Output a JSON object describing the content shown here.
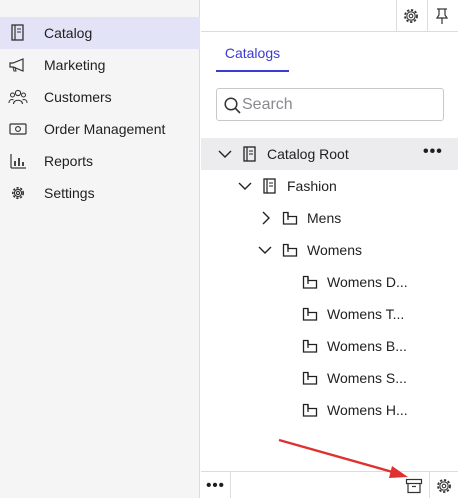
{
  "nav": {
    "items": [
      {
        "label": "Catalog",
        "icon": "catalog-book-icon",
        "active": true
      },
      {
        "label": "Marketing",
        "icon": "megaphone-icon",
        "active": false
      },
      {
        "label": "Customers",
        "icon": "people-icon",
        "active": false
      },
      {
        "label": "Order Management",
        "icon": "money-icon",
        "active": false
      },
      {
        "label": "Reports",
        "icon": "bar-chart-icon",
        "active": false
      },
      {
        "label": "Settings",
        "icon": "gear-icon",
        "active": false
      }
    ]
  },
  "panel": {
    "topbar": {
      "settings_icon": "gear-icon",
      "pin_icon": "pin-icon"
    },
    "tab_label": "Catalogs",
    "search": {
      "placeholder": "Search",
      "value": ""
    },
    "tree": {
      "root": {
        "label": "Catalog Root",
        "expanded": true,
        "more_label": "•••"
      },
      "catalog": {
        "label": "Fashion",
        "expanded": true
      },
      "categories": [
        {
          "label": "Mens",
          "expanded": false
        },
        {
          "label": "Womens",
          "expanded": true
        }
      ],
      "subcategories": [
        {
          "label": "Womens D..."
        },
        {
          "label": "Womens T..."
        },
        {
          "label": "Womens B..."
        },
        {
          "label": "Womens S..."
        },
        {
          "label": "Womens H..."
        }
      ]
    },
    "bottombar": {
      "more_label": "•••",
      "archive_icon": "archive-box-icon",
      "settings_icon": "gear-icon"
    }
  },
  "annotation": {
    "arrow_color": "#e03131"
  },
  "colors": {
    "accent": "#3b3bd1",
    "active_bg": "#e3e3f7",
    "root_bg": "#ececef"
  }
}
